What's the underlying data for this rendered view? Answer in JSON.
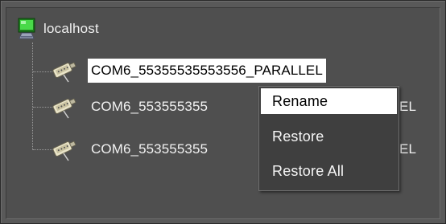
{
  "tree": {
    "root": {
      "label": "localhost",
      "icon": "computer-icon"
    },
    "items": [
      {
        "label": "COM6_55355535553556_PARALLEL",
        "selected": true,
        "icon": "serial-port-icon"
      },
      {
        "label": "COM6_553555355",
        "trailing": "EL",
        "selected": false,
        "icon": "serial-port-icon"
      },
      {
        "label": "COM6_553555355",
        "trailing": "EL",
        "selected": false,
        "icon": "serial-port-icon"
      }
    ]
  },
  "context_menu": {
    "items": [
      {
        "label": "Rename",
        "highlighted": true
      },
      {
        "label": "Restore",
        "highlighted": false
      },
      {
        "label": "Restore All",
        "highlighted": false
      }
    ]
  },
  "colors": {
    "background": "#585858",
    "selection": "#ffffff",
    "menu_bg": "#3f3f3f",
    "text": "#f2f2f2"
  }
}
